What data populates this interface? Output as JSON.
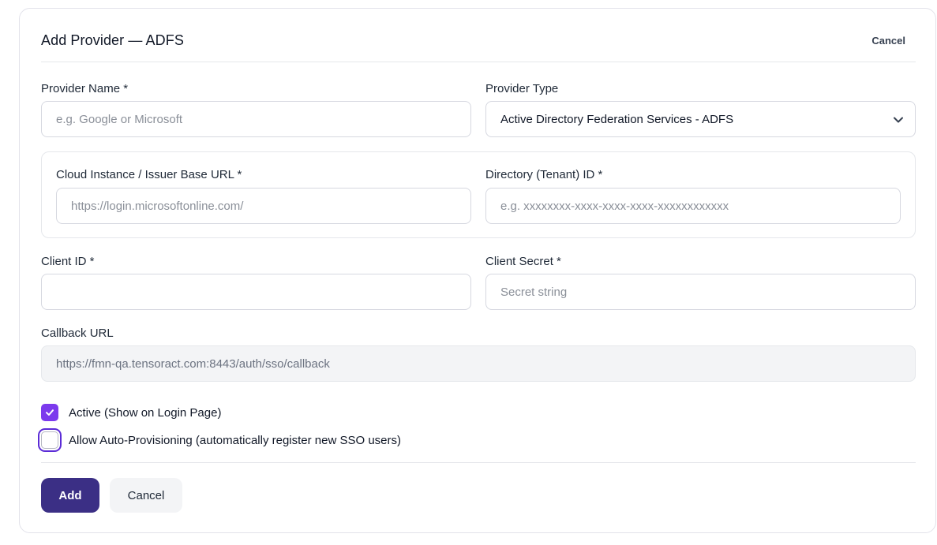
{
  "header": {
    "title": "Add Provider — ADFS",
    "cancel_label": "Cancel"
  },
  "form": {
    "provider_name": {
      "label": "Provider Name *",
      "value": "",
      "placeholder": "e.g. Google or Microsoft"
    },
    "provider_type": {
      "label": "Provider Type",
      "selected": "Active Directory Federation Services - ADFS"
    },
    "issuer_base_url": {
      "label": "Cloud Instance / Issuer Base URL *",
      "value": "",
      "placeholder": "https://login.microsoftonline.com/"
    },
    "tenant_id": {
      "label": "Directory (Tenant) ID *",
      "value": "",
      "placeholder": "e.g. xxxxxxxx-xxxx-xxxx-xxxx-xxxxxxxxxxxx"
    },
    "client_id": {
      "label": "Client ID *",
      "value": "",
      "placeholder": ""
    },
    "client_secret": {
      "label": "Client Secret *",
      "value": "",
      "placeholder": "Secret string"
    },
    "callback_url": {
      "label": "Callback URL",
      "value": "https://fmn-qa.tensoract.com:8443/auth/sso/callback"
    },
    "active": {
      "label": "Active (Show on Login Page)",
      "checked": true
    },
    "auto_provisioning": {
      "label": "Allow Auto-Provisioning (automatically register new SSO users)",
      "checked": false
    }
  },
  "footer": {
    "add_label": "Add",
    "cancel_label": "Cancel"
  },
  "colors": {
    "accent": "#7c3aed",
    "primary_button": "#3b2f85",
    "secondary_button": "#f3f4f6",
    "readonly_field": "#f3f4f6"
  }
}
